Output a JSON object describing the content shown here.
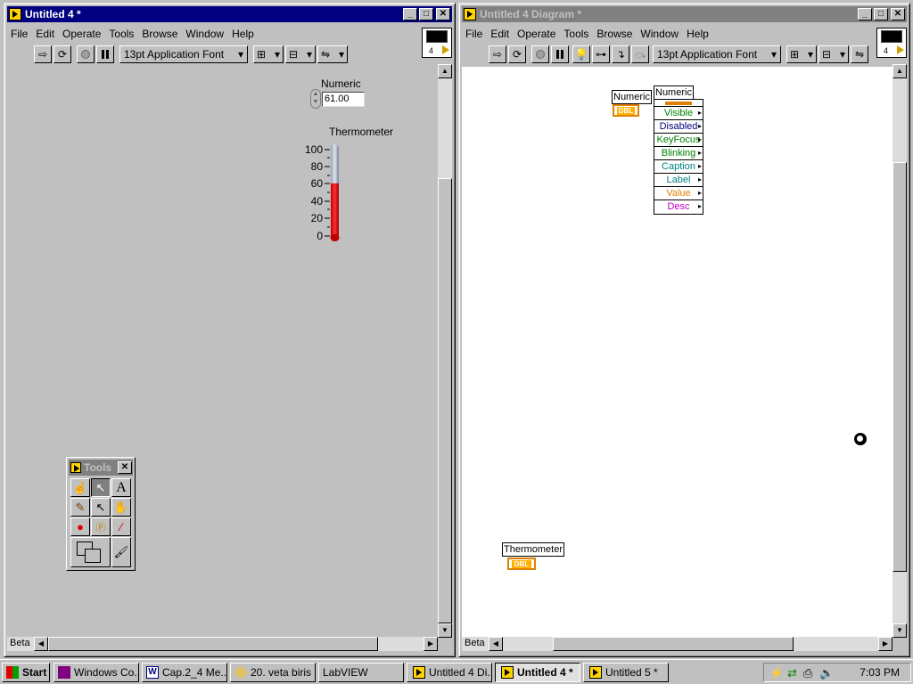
{
  "front_panel": {
    "title": "Untitled 4 *",
    "menu": [
      "File",
      "Edit",
      "Operate",
      "Tools",
      "Browse",
      "Window",
      "Help"
    ],
    "font_select": "13pt Application Font",
    "vi_icon_number": "4",
    "numeric": {
      "label": "Numeric",
      "value": "61.00"
    },
    "thermometer": {
      "label": "Thermometer",
      "scale": [
        "100",
        "80",
        "60",
        "40",
        "20",
        "0"
      ],
      "min": 0,
      "max": 100,
      "level": 61
    },
    "status": "Beta"
  },
  "tools_palette": {
    "title": "Tools",
    "tools": [
      "operate-hand",
      "position-select",
      "edit-text",
      "connect-wire",
      "object-shortcut-menu",
      "scroll",
      "breakpoint",
      "probe",
      "get-color",
      "set-color",
      "color-brush"
    ]
  },
  "diagram": {
    "title": "Untitled 4 Diagram *",
    "menu": [
      "File",
      "Edit",
      "Operate",
      "Tools",
      "Browse",
      "Window",
      "Help"
    ],
    "font_select": "13pt Application Font",
    "vi_icon_number": "4",
    "numeric_terminal": {
      "label": "Numeric",
      "type": "DBL"
    },
    "thermometer_terminal": {
      "label": "Thermometer",
      "type": "DBL"
    },
    "property_node": {
      "label": "Numeric",
      "properties": [
        {
          "name": "Visible",
          "color": "#008000"
        },
        {
          "name": "Disabled",
          "color": "#000080"
        },
        {
          "name": "KeyFocus",
          "color": "#008000"
        },
        {
          "name": "Blinking",
          "color": "#008000"
        },
        {
          "name": "Caption",
          "color": "#008080"
        },
        {
          "name": "Label",
          "color": "#008080"
        },
        {
          "name": "Value",
          "color": "#e08000"
        },
        {
          "name": "Desc",
          "color": "#c000c0"
        }
      ]
    },
    "status": "Beta"
  },
  "taskbar": {
    "start_label": "Start",
    "tasks": [
      "Windows Co...",
      "Cap.2_4 Me...",
      "20. veta biris ...",
      "LabVIEW",
      "Untitled 4 Di...",
      "Untitled 4 *",
      "Untitled 5 *"
    ],
    "clock": "7:03 PM"
  }
}
